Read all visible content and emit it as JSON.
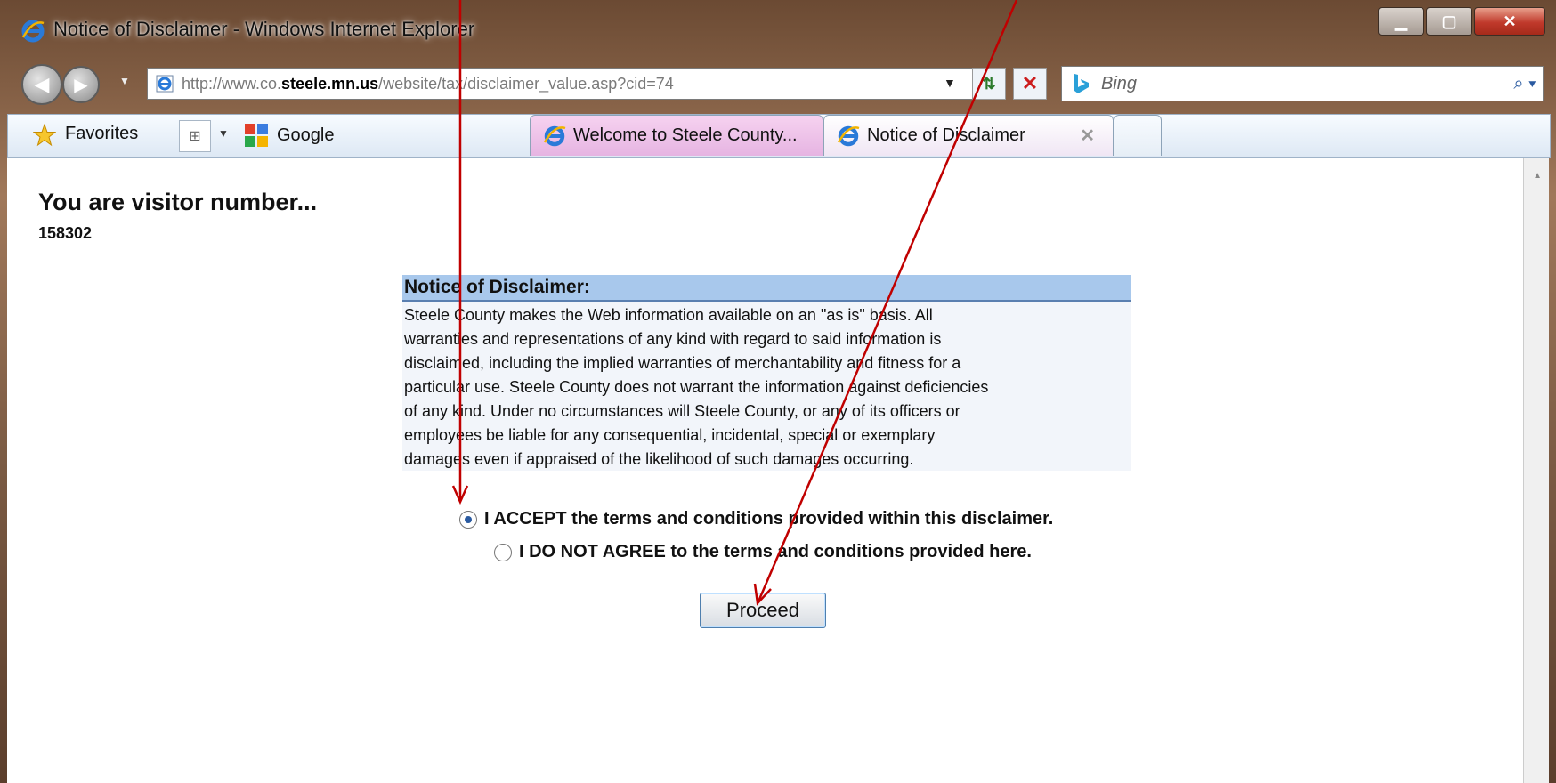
{
  "window": {
    "title": "Notice of Disclaimer - Windows Internet Explorer",
    "controls": [
      "minimize-icon",
      "maximize-icon",
      "close-icon"
    ]
  },
  "nav": {
    "address_prefix": "http://www.co.",
    "address_domain": "steele.mn.us",
    "address_path": "/website/tax/disclaimer_value.asp?cid=74",
    "search_placeholder": "Bing"
  },
  "favorites": {
    "label": "Favorites",
    "links": [
      {
        "label": "Google",
        "icon": "google-icon"
      }
    ]
  },
  "tabs": [
    {
      "title": "Welcome to Steele County...",
      "active": false
    },
    {
      "title": "Notice of Disclaimer",
      "active": true
    }
  ],
  "page": {
    "visitor_heading": "You are visitor number...",
    "visitor_count": "158302",
    "disclaimer_title": "Notice of Disclaimer:",
    "disclaimer_lines": [
      "Steele County makes the Web information available on an \"as is\" basis. All",
      "warranties and representations of any kind with regard to said information is",
      "disclaimed, including the implied warranties of merchantability and fitness for a",
      "particular use. Steele County does not warrant the information against deficiencies",
      "of any kind. Under no circumstances will Steele County, or any of its officers or",
      "employees be liable for any consequential, incidental, special or exemplary",
      "damages even if appraised of the likelihood of such damages occurring."
    ],
    "accept_label": "I ACCEPT the terms and conditions provided within this disclaimer.",
    "decline_label": "I DO NOT AGREE to the terms and conditions provided here.",
    "accept_selected": true,
    "proceed_label": "Proceed"
  },
  "colors": {
    "annotation_arrow": "#c00000",
    "disclaimer_header_bg": "#a8c8ec",
    "disclaimer_body_bg": "#f2f5fa"
  }
}
